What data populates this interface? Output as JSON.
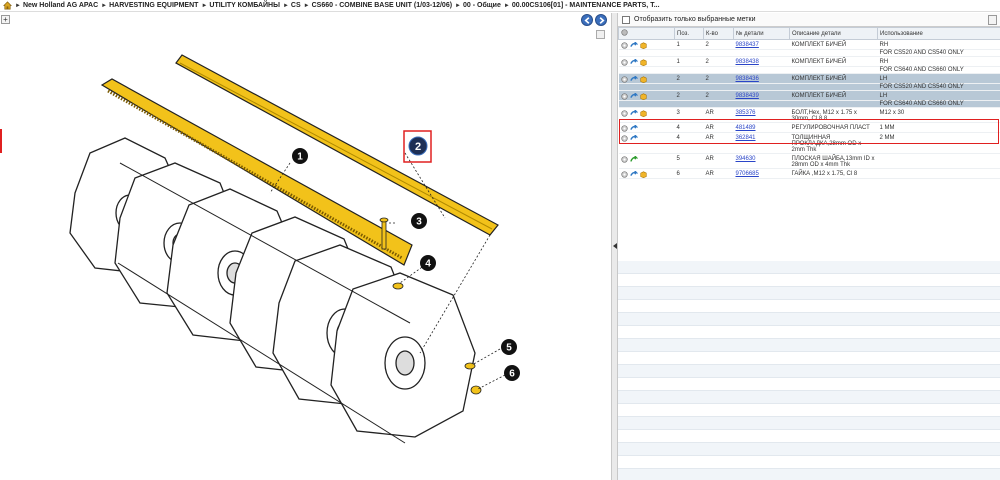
{
  "breadcrumb": [
    "New Holland AG APAC",
    "HARVESTING EQUIPMENT",
    "UTILITY КОМБАЙНЫ",
    "CS",
    "CS660 - COMBINE BASE UNIT (1/03-12/06)",
    "00 - Общие",
    "00.00CS106[01] - MAINTENANCE PARTS, T..."
  ],
  "filter": {
    "label": "Отобразить только выбранные метки"
  },
  "table": {
    "headers": [
      "Поз.",
      "К-во",
      "№ детали",
      "Описание детали",
      "Использование"
    ],
    "rows": [
      {
        "pos": "1",
        "qty": "2",
        "part": "9838437",
        "desc": "КОМПЛЕКТ БИЧЕЙ",
        "usage": "RH",
        "usage2": "FOR CS520 AND CS540 ONLY",
        "icons": [
          "gear",
          "arrow",
          "box"
        ],
        "state": "normal"
      },
      {
        "pos": "1",
        "qty": "2",
        "part": "9838438",
        "desc": "КОМПЛЕКТ БИЧЕЙ",
        "usage": "RH",
        "usage2": "FOR CS640 AND CS660 ONLY",
        "icons": [
          "gear",
          "arrow",
          "box"
        ],
        "state": "normal"
      },
      {
        "pos": "2",
        "qty": "2",
        "part": "9838436",
        "desc": "КОМПЛЕКТ БИЧЕЙ",
        "usage": "LH",
        "usage2": "FOR CS520 AND CS540 ONLY",
        "icons": [
          "gear",
          "arrow",
          "box"
        ],
        "state": "selected"
      },
      {
        "pos": "2",
        "qty": "2",
        "part": "9838439",
        "desc": "КОМПЛЕКТ БИЧЕЙ",
        "usage": "LH",
        "usage2": "FOR CS640 AND CS660 ONLY",
        "icons": [
          "gear",
          "arrow",
          "box"
        ],
        "state": "selected"
      },
      {
        "pos": "3",
        "qty": "AR",
        "part": "385376",
        "desc": "БОЛТ,Hex, M12 x 1.75 x 30mm, Cl 8.8",
        "usage": "M12 x 30",
        "usage2": "",
        "icons": [
          "gear",
          "arrow",
          "box"
        ],
        "state": "normal"
      },
      {
        "pos": "4",
        "qty": "AR",
        "part": "481489",
        "desc": "РЕГУЛИРОВОЧНАЯ ПЛАСТ",
        "usage": "1 MM",
        "usage2": "",
        "icons": [
          "gear",
          "arrow"
        ],
        "state": "normal"
      },
      {
        "pos": "4",
        "qty": "AR",
        "part": "362841",
        "desc": "ТОЛЩИННАЯ ПРОКЛАДКА,28mm OD x 2mm Thk",
        "usage": "2 MM",
        "usage2": "",
        "icons": [
          "gear",
          "arrow"
        ],
        "state": "normal"
      },
      {
        "pos": "5",
        "qty": "AR",
        "part": "394630",
        "desc": "ПЛОСКАЯ ШАЙБА,13mm ID x 28mm OD x 4mm Thk",
        "usage": "",
        "usage2": "",
        "icons": [
          "gear",
          "greenarrow"
        ],
        "state": "normal"
      },
      {
        "pos": "6",
        "qty": "AR",
        "part": "9706685",
        "desc": "ГАЙКА ,M12 x 1.75, Cl 8",
        "usage": "",
        "usage2": "",
        "icons": [
          "gear",
          "arrow",
          "box"
        ],
        "state": "normal"
      }
    ]
  },
  "diagram": {
    "callouts": [
      "1",
      "2",
      "3",
      "4",
      "5",
      "6"
    ],
    "selected_callout": "2"
  },
  "colors": {
    "accent": "#3b6fbd",
    "selection": "#b8c8d6",
    "highlight": "#e02020",
    "part": "#f2c21a"
  }
}
